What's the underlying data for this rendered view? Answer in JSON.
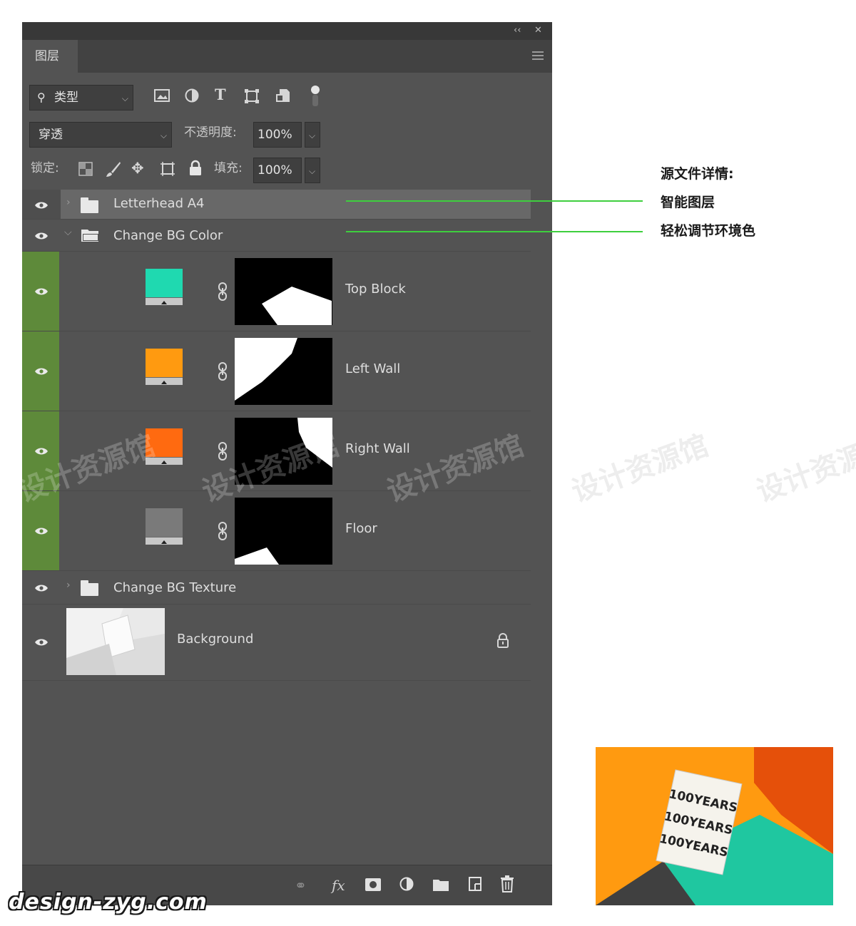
{
  "panel": {
    "tab_label": "图层",
    "filter": {
      "label": "类型"
    },
    "blend_mode": "穿透",
    "opacity_label": "不透明度:",
    "opacity_value": "100%",
    "lock_label": "锁定:",
    "fill_label": "填充:",
    "fill_value": "100%"
  },
  "layers": [
    {
      "name": "Letterhead A4",
      "kind": "group",
      "expanded": false
    },
    {
      "name": "Change BG Color",
      "kind": "group",
      "expanded": true
    },
    {
      "name": "Top Block",
      "kind": "fill",
      "color": "#1fd9b0"
    },
    {
      "name": "Left Wall",
      "kind": "fill",
      "color": "#ff9a10"
    },
    {
      "name": "Right Wall",
      "kind": "fill",
      "color": "#ff6a10"
    },
    {
      "name": "Floor",
      "kind": "fill",
      "color": "#7a7a7a"
    },
    {
      "name": "Change BG Texture",
      "kind": "group",
      "expanded": false
    },
    {
      "name": "Background",
      "kind": "image",
      "locked": true
    }
  ],
  "annotations": {
    "title": "源文件详情:",
    "item1": "智能图层",
    "item2": "轻松调节环境色"
  },
  "watermark": "设计资源馆",
  "brand": "design-zyg.com",
  "preview_text": "100YEARS",
  "colors": {
    "panel_bg": "#535353",
    "highlight": "#5e8a3a",
    "annotation_line": "#3ecf3e"
  }
}
